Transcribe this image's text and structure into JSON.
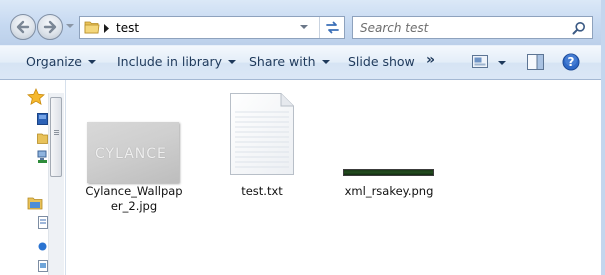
{
  "address": {
    "breadcrumb": [
      "test"
    ],
    "icons": [
      "back-arrow-icon",
      "forward-arrow-icon",
      "folder-icon",
      "refresh-icon",
      "search-icon"
    ]
  },
  "search": {
    "placeholder": "Search test"
  },
  "toolbar": {
    "organize": "Organize",
    "include_in_library": "Include in library",
    "share_with": "Share with",
    "slide_show": "Slide show",
    "more": "»"
  },
  "files": [
    {
      "name": "Cylance_Wallpap\ner_2.jpg",
      "line1": "Cylance_Wallpap",
      "line2": "er_2.jpg",
      "watermark": "CYLANCE",
      "kind": "image"
    },
    {
      "name": "test.txt",
      "kind": "text"
    },
    {
      "name": "xml_rsakey.png",
      "kind": "image"
    }
  ],
  "colors": {
    "toolbar_text": "#1e395b",
    "chrome": "#c6d9f1",
    "content_bg": "#ffffff"
  }
}
